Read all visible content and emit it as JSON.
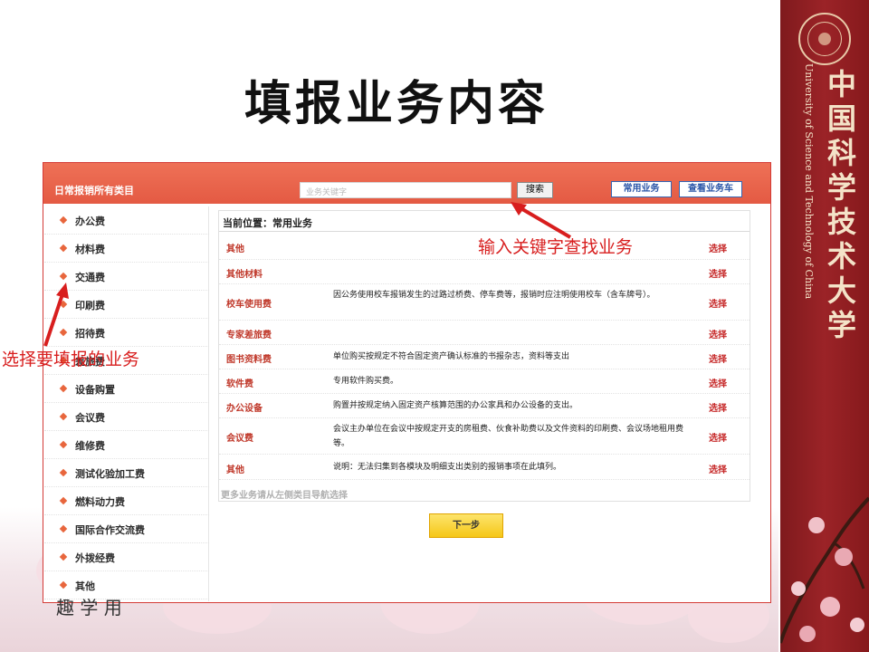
{
  "slide": {
    "title": "填报业务内容",
    "university_cn": "中国科学技术大学",
    "university_en": "University of Science and Technology of China",
    "bottom_text": "趣 学 用",
    "colors": {
      "banner": "#8e1f22",
      "accent": "#e8624a",
      "annotation": "#d81e1e"
    }
  },
  "app": {
    "category_title": "日常报销所有类目",
    "search": {
      "placeholder": "业务关键字",
      "button": "搜索"
    },
    "buttons": {
      "common": "常用业务",
      "cart": "查看业务车"
    }
  },
  "sidebar": {
    "items": [
      "办公费",
      "材料费",
      "交通费",
      "印刷费",
      "招待费",
      "差旅费",
      "设备购置",
      "会议费",
      "维修费",
      "测试化验加工费",
      "燃料动力费",
      "国际合作交流费",
      "外拨经费",
      "其他"
    ]
  },
  "content": {
    "breadcrumb": "当前位置：常用业务",
    "select_label": "选择",
    "rows": [
      {
        "name": "其他",
        "desc": ""
      },
      {
        "name": "其他材料",
        "desc": ""
      },
      {
        "name": "校车使用费",
        "desc": "因公务使用校车报销发生的过路过桥费、停车费等，报销时应注明使用校车（含车牌号）。"
      },
      {
        "name": "专家差旅费",
        "desc": ""
      },
      {
        "name": "图书资料费",
        "desc": "单位购买按规定不符合固定资产确认标准的书报杂志，资料等支出"
      },
      {
        "name": "软件费",
        "desc": "专用软件购买费。"
      },
      {
        "name": "办公设备",
        "desc": "购置并按规定纳入固定资产核算范围的办公家具和办公设备的支出。"
      },
      {
        "name": "会议费",
        "desc": "会议主办单位在会议中按规定开支的房租费、伙食补助费以及文件资料的印刷费、会议场地租用费等。"
      },
      {
        "name": "其他",
        "desc": "说明：无法归集到各模块及明细支出类别的报销事项在此填列。"
      }
    ],
    "more_hint": "更多业务请从左侧类目导航选择",
    "next_button": "下一步"
  },
  "annotations": {
    "keyword": "输入关键字查找业务",
    "choose": "选择要填报的业务"
  }
}
